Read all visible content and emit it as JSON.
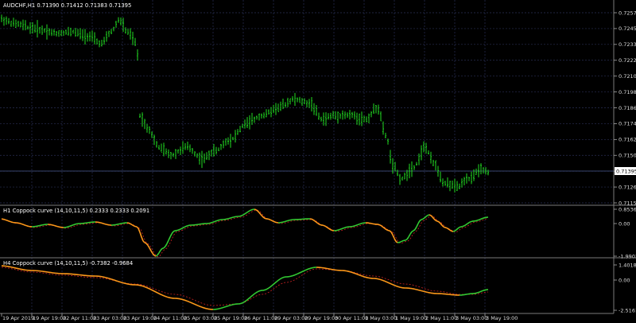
{
  "main_title": "AUDCHF,H1  0.71390 0.71412 0.71383 0.71395",
  "price_ticks": [
    "0.72575",
    "0.72455",
    "0.72335",
    "0.72220",
    "0.72105",
    "0.71985",
    "0.71865",
    "0.71745",
    "0.71625",
    "0.71505",
    "0.71385",
    "0.71265",
    "0.71150"
  ],
  "current_price": "0.71395",
  "ind1": {
    "title": "H1 Coppock curve (14,10,11,5) 0.2333 0.2333 0.2091",
    "ticks": [
      "0.8536",
      "0.00",
      "-1.9902"
    ]
  },
  "ind2": {
    "title": "H4 Coppock curve (14,10,11,5) -0.7382 -0.9684",
    "ticks": [
      "1.4018",
      "0.00",
      "-2.5161"
    ]
  },
  "time_labels": [
    "19 Apr 2019",
    "19 Apr 19:00",
    "22 Apr 11:00",
    "23 Apr 03:00",
    "23 Apr 19:00",
    "24 Apr 11:00",
    "25 Apr 03:00",
    "25 Apr 19:00",
    "26 Apr 11:00",
    "29 Apr 03:00",
    "29 Apr 19:00",
    "30 Apr 11:00",
    "1 May 03:00",
    "1 May 19:00",
    "2 May 11:00",
    "3 May 03:00",
    "3 May 19:00"
  ],
  "colors": {
    "bars": "#22dd22",
    "coppock_up": "#33cc33",
    "coppock_down": "#ff9a1a",
    "signal": "#cc2222",
    "grid": "#2a2f55",
    "price_line": "#5a6aa0"
  },
  "chart_data": {
    "type": "line",
    "title": "AUDCHF,H1",
    "x": [
      "19 Apr 2019",
      "19 Apr 19:00",
      "22 Apr 11:00",
      "23 Apr 03:00",
      "23 Apr 19:00",
      "24 Apr 11:00",
      "25 Apr 03:00",
      "25 Apr 19:00",
      "26 Apr 11:00",
      "29 Apr 03:00",
      "29 Apr 19:00",
      "30 Apr 11:00",
      "1 May 03:00",
      "1 May 19:00",
      "2 May 11:00",
      "3 May 03:00",
      "3 May 19:00"
    ],
    "series": [
      {
        "name": "AUDCHF,H1",
        "values": [
          0.725,
          0.7245,
          0.7242,
          0.7238,
          0.7246,
          0.718,
          0.7155,
          0.7165,
          0.7185,
          0.7195,
          0.7196,
          0.7188,
          0.714,
          0.7155,
          0.713,
          0.7132,
          0.714
        ]
      },
      {
        "name": "H1 Coppock curve (14,10,11,5)",
        "values": [
          0.1,
          0.0,
          0.05,
          0.1,
          -0.1,
          -1.6,
          -0.3,
          0.2,
          0.7,
          0.5,
          0.2,
          0.1,
          0.0,
          -0.9,
          0.5,
          -0.4,
          0.23
        ]
      },
      {
        "name": "H4 Coppock curve (14,10,11,5)",
        "values": [
          1.4,
          1.0,
          0.6,
          0.3,
          -0.2,
          -0.9,
          -1.8,
          -2.5,
          -1.5,
          -0.2,
          0.5,
          1.1,
          0.6,
          -0.2,
          -0.5,
          -0.85,
          -0.74
        ]
      }
    ],
    "ylim": [
      0.7115,
      0.7265
    ]
  }
}
